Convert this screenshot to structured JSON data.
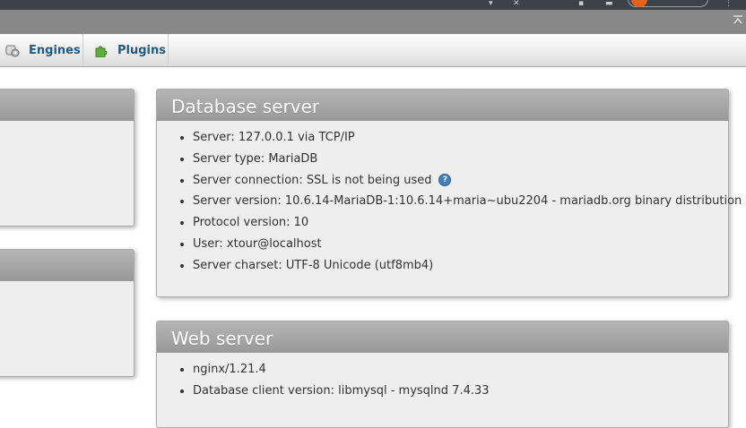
{
  "tabs": [
    {
      "label": "Engines",
      "icon": "engines-icon"
    },
    {
      "label": "Plugins",
      "icon": "plugins-icon"
    }
  ],
  "database_server": {
    "title": "Database server",
    "items": [
      "Server: 127.0.0.1 via TCP/IP",
      "Server type: MariaDB",
      "Server connection: SSL is not being used",
      "Server version: 10.6.14-MariaDB-1:10.6.14+maria~ubu2204 - mariadb.org binary distribution",
      "Protocol version: 10",
      "User: xtour@localhost",
      "Server charset: UTF-8 Unicode (utf8mb4)"
    ],
    "help_icon": "help-icon"
  },
  "web_server": {
    "title": "Web server",
    "items": [
      "nginx/1.21.4",
      "Database client version: libmysql - mysqlnd 7.4.33"
    ]
  },
  "colors": {
    "tab_text": "#235a81",
    "panel_bg": "#eeeeee",
    "panel_header": "#a8a8a8",
    "topbar": "#888888"
  }
}
